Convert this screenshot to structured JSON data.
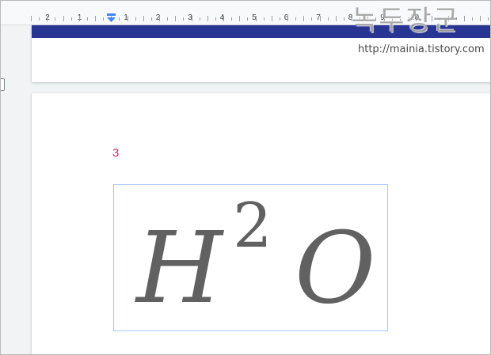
{
  "ruler": {
    "labels": [
      "2",
      "1",
      "1",
      "2",
      "3",
      "4",
      "5",
      "6",
      "7",
      "8",
      "9",
      "10"
    ]
  },
  "document": {
    "page_number": "3",
    "equation": {
      "base": "H",
      "superscript": "2",
      "trailing": "O"
    }
  },
  "watermark": {
    "title": "녹두장군",
    "url": "http://mainia.tistory.com"
  },
  "colors": {
    "banner": "#283593",
    "page_number": "#e91e63",
    "equation_text": "#616161",
    "selection_border": "#a8c7fa"
  }
}
